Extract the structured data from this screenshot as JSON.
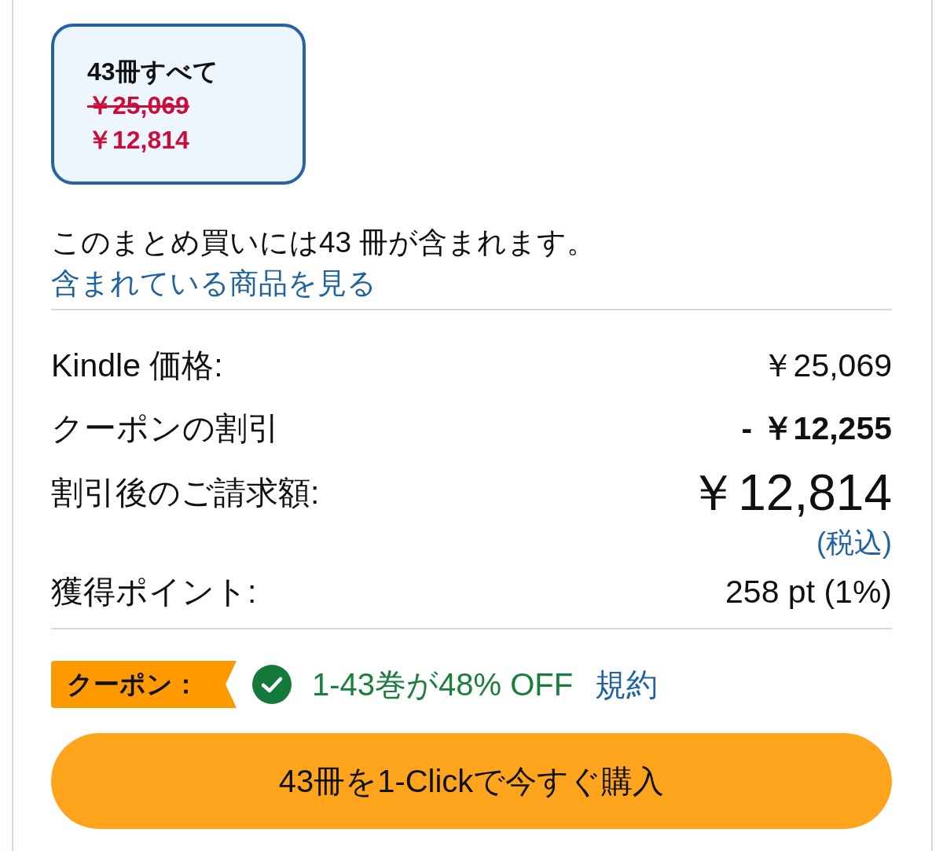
{
  "bundle_option": {
    "label": "43冊すべて",
    "list_price": "￥25,069",
    "price": "￥12,814",
    "selected": true
  },
  "summary": {
    "text": "このまとめ買いには43 冊が含まれます。",
    "link": "含まれている商品を見る"
  },
  "price_rows": [
    {
      "kind": "regular",
      "label": "Kindle 価格:",
      "value": "￥25,069"
    },
    {
      "kind": "discount",
      "label": "クーポンの割引",
      "value": "- ￥12,255"
    },
    {
      "kind": "total",
      "label": "割引後のご請求額:",
      "value": "￥12,814",
      "note": "(税込)"
    },
    {
      "kind": "regular",
      "label": "獲得ポイント:",
      "value": "258 pt (1%)"
    }
  ],
  "coupon": {
    "badge": "クーポン：",
    "applied": true,
    "text": "1-43巻が48% OFF",
    "terms_link": "規約"
  },
  "buy_button": {
    "label": "43冊を1-Clickで今すぐ購入"
  }
}
